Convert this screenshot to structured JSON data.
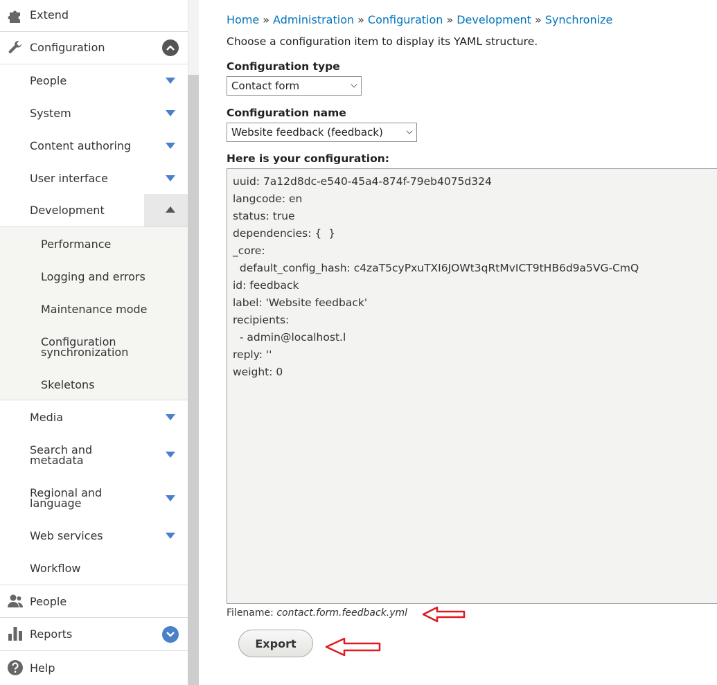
{
  "sidebar": {
    "top_items": [
      {
        "label": "Extend",
        "icon": "puzzle-icon"
      },
      {
        "label": "Configuration",
        "icon": "wrench-icon"
      },
      {
        "label": "People",
        "icon": "people-icon"
      },
      {
        "label": "Reports",
        "icon": "bar-chart-icon"
      },
      {
        "label": "Help",
        "icon": "question-icon"
      }
    ],
    "config_items": [
      {
        "label": "People"
      },
      {
        "label": "System"
      },
      {
        "label": "Content authoring"
      },
      {
        "label": "User interface"
      },
      {
        "label": "Development"
      },
      {
        "label": "Media"
      },
      {
        "label": "Search and metadata"
      },
      {
        "label": "Regional and language"
      },
      {
        "label": "Web services"
      },
      {
        "label": "Workflow"
      }
    ],
    "development_items": [
      {
        "label": "Performance"
      },
      {
        "label": "Logging and errors"
      },
      {
        "label": "Maintenance mode"
      },
      {
        "label": "Configuration synchronization"
      },
      {
        "label": "Skeletons"
      }
    ]
  },
  "breadcrumb": [
    "Home",
    "Administration",
    "Configuration",
    "Development",
    "Synchronize"
  ],
  "breadcrumb_separator": "»",
  "intro_text": "Choose a configuration item to display its YAML structure.",
  "form": {
    "config_type_label": "Configuration type",
    "config_type_value": "Contact form",
    "config_name_label": "Configuration name",
    "config_name_value": "Website feedback (feedback)",
    "config_output_label": "Here is your configuration:",
    "yaml_lines": [
      "uuid: 7a12d8dc-e540-45a4-874f-79eb4075d324",
      "langcode: en",
      "status: true",
      "dependencies: {  }",
      "_core:",
      "  default_config_hash: c4zaT5cyPxuTXI6JOWt3qRtMvICT9tHB6d9a5VG-CmQ",
      "id: feedback",
      "label: 'Website feedback'",
      "recipients:",
      "  - admin@localhost.l",
      "reply: ''",
      "weight: 0"
    ],
    "filename_label": "Filename:",
    "filename_value": "contact.form.feedback.yml",
    "export_label": "Export"
  },
  "colors": {
    "link": "#0074bd",
    "annotation_arrow": "#e0191f",
    "expand_triangle": "#4a80c9"
  }
}
